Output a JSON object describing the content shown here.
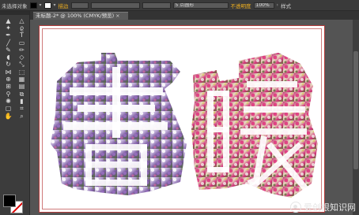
{
  "app": {
    "control_bar": {
      "selection_label": "未选择对象",
      "stroke_label": "描边",
      "opacity_label": "5 点圆形",
      "style_label": "不透明度",
      "opacity_value": "100%"
    },
    "tab": {
      "title": "未标题-2* @ 100% (CMYK/预览)",
      "close": "×"
    }
  },
  "artwork": {
    "char1": "春",
    "char2": "暖"
  },
  "watermark": {
    "text": "爱创根知识网"
  },
  "colors": {
    "fill": "#000000",
    "stroke": "#ffffff",
    "artboard_border": "#b23a3a"
  },
  "tools": [
    "selection-tool-icon",
    "direct-selection-tool-icon",
    "magic-wand-tool-icon",
    "lasso-tool-icon",
    "pen-tool-icon",
    "type-tool-icon",
    "line-segment-tool-icon",
    "rectangle-tool-icon",
    "paintbrush-tool-icon",
    "pencil-tool-icon",
    "blob-brush-tool-icon",
    "eraser-tool-icon",
    "rotate-tool-icon",
    "scale-tool-icon",
    "width-tool-icon",
    "free-transform-tool-icon",
    "shape-builder-tool-icon",
    "perspective-grid-tool-icon",
    "mesh-tool-icon",
    "gradient-tool-icon",
    "eyedropper-tool-icon",
    "blend-tool-icon",
    "symbol-sprayer-tool-icon",
    "column-graph-tool-icon",
    "artboard-tool-icon",
    "slice-tool-icon",
    "hand-tool-icon",
    "zoom-tool-icon"
  ]
}
